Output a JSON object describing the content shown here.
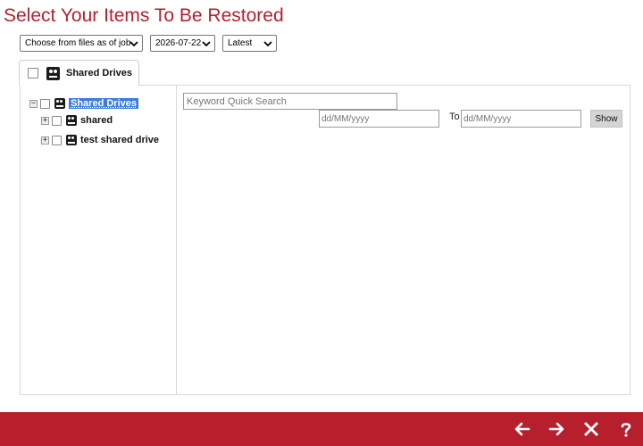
{
  "page": {
    "title": "Select Your Items To Be Restored"
  },
  "filters": {
    "job_mode": "Choose from files as of job",
    "date": "2026-07-22",
    "version": "Latest"
  },
  "tab": {
    "label": "Shared Drives"
  },
  "tree": {
    "root_label": "Shared Drives",
    "items": [
      {
        "label": "shared"
      },
      {
        "label": "test shared drive"
      }
    ]
  },
  "search": {
    "placeholder": "Keyword Quick Search",
    "date_from_placeholder": "dd/MM/yyyy",
    "to_label": "To",
    "date_to_placeholder": "dd/MM/yyyy",
    "show_label": "Show"
  },
  "footer": {
    "back_icon": "arrow-left-icon",
    "next_icon": "arrow-right-icon",
    "close_icon": "close-icon",
    "help_icon": "question-icon"
  },
  "colors": {
    "accent": "#b81f2d",
    "title": "#b5202e",
    "selection": "#3b7ddd"
  }
}
